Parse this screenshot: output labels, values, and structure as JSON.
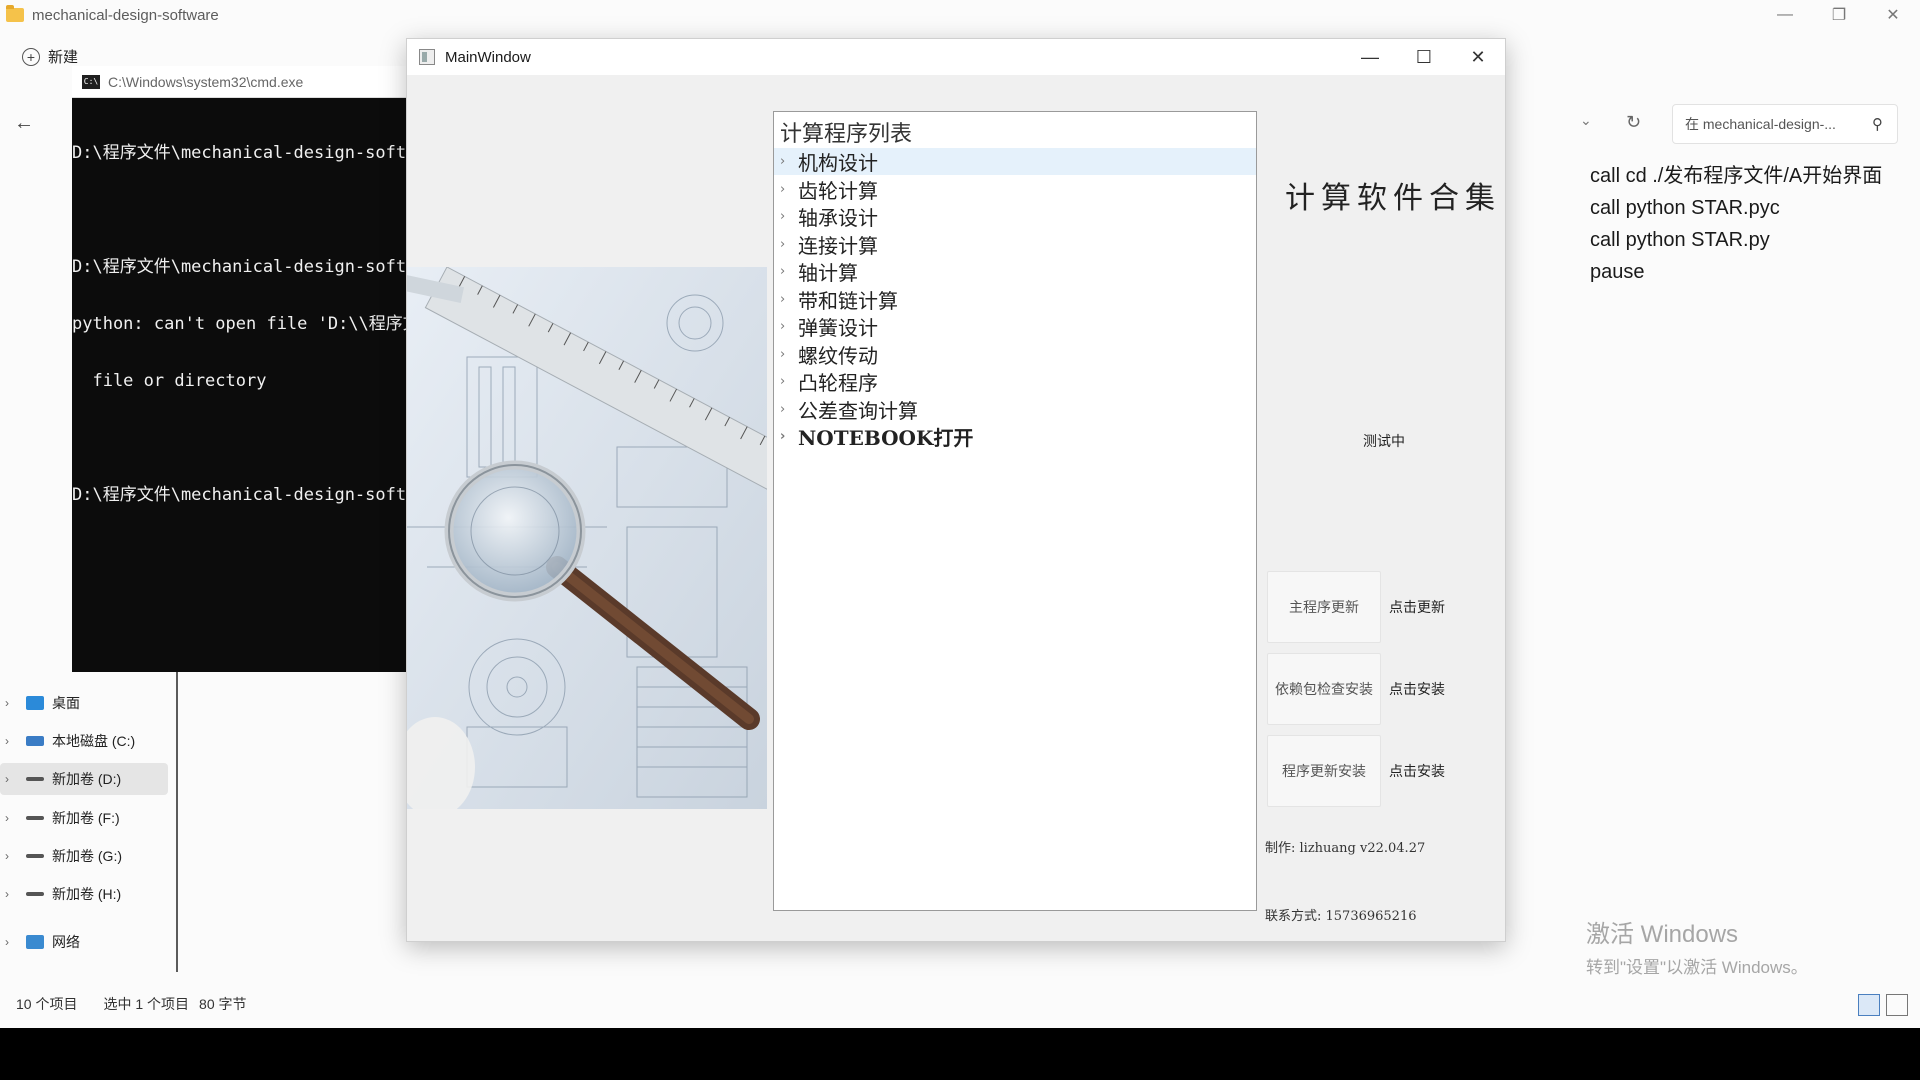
{
  "explorer": {
    "title": "mechanical-design-software",
    "new_label": "新建",
    "search_placeholder": "在 mechanical-design-...",
    "nav_items": [
      {
        "label": "桌面",
        "icon": "desktop-icon",
        "color": "#2b8ad9"
      },
      {
        "label": "本地磁盘 (C:)",
        "icon": "drive-icon",
        "color": "#3a7cc5"
      },
      {
        "label": "新加卷 (D:)",
        "icon": "drive-icon",
        "color": "#555555"
      },
      {
        "label": "新加卷 (F:)",
        "icon": "drive-icon",
        "color": "#555555"
      },
      {
        "label": "新加卷 (G:)",
        "icon": "drive-icon",
        "color": "#555555"
      },
      {
        "label": "新加卷 (H:)",
        "icon": "drive-icon",
        "color": "#555555"
      },
      {
        "label": "网络",
        "icon": "network-icon",
        "color": "#3a8ad0"
      }
    ],
    "file_lines": [
      "call cd ./发布程序文件/A开始界面",
      "call python STAR.pyc",
      "call python STAR.py",
      "pause"
    ],
    "status": {
      "count": "10 个项目",
      "selected": "选中 1 个项目",
      "size": "80 字节"
    },
    "activate": {
      "line1": "激活 Windows",
      "line2": "转到\"设置\"以激活 Windows。"
    }
  },
  "cmd": {
    "title": "C:\\Windows\\system32\\cmd.exe",
    "lines": [
      "D:\\程序文件\\mechanical-design-softw",
      "",
      "D:\\程序文件\\mechanical-design-softw",
      "python: can't open file 'D:\\\\程序文",
      "  file or directory",
      "",
      "D:\\程序文件\\mechanical-design-softw"
    ]
  },
  "main_window": {
    "title": "MainWindow",
    "tree_header": "计算程序列表",
    "tree_items": [
      "机构设计",
      "齿轮计算",
      "轴承设计",
      "连接计算",
      "轴计算",
      "带和链计算",
      "弹簧设计",
      "螺纹传动",
      "凸轮程序",
      "公差查询计算",
      "NOTEBOOK打开"
    ],
    "app_title": "计算软件合集",
    "status_text": "测试中",
    "actions": [
      {
        "button": "主程序更新",
        "label": "点击更新"
      },
      {
        "button": "依赖包检查安装",
        "label": "点击安装"
      },
      {
        "button": "程序更新安装",
        "label": "点击安装"
      }
    ],
    "author": "制作: lizhuang v22.04.27",
    "contact": "联系方式: 15736965216"
  }
}
